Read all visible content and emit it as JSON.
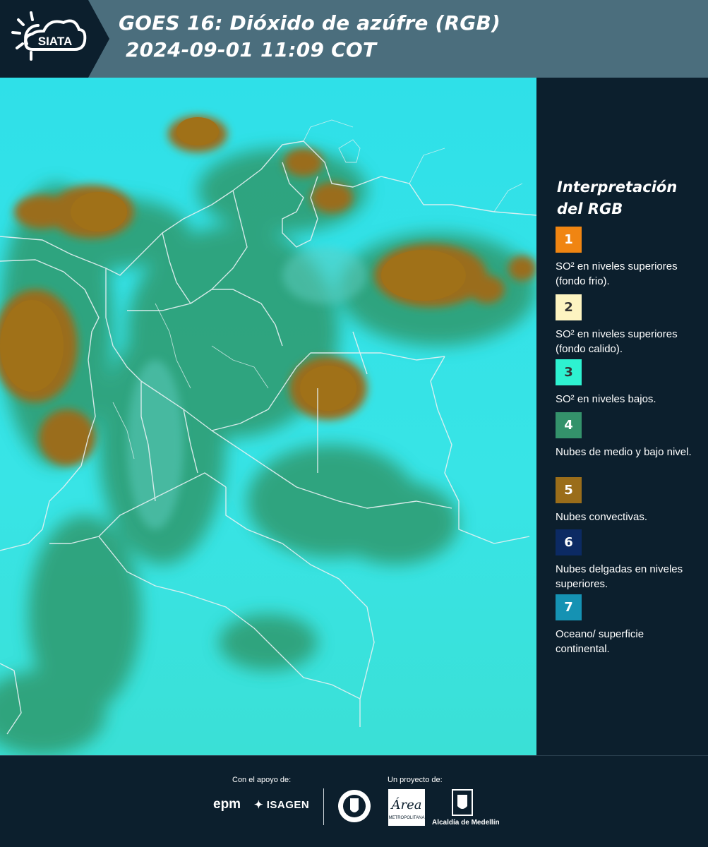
{
  "header": {
    "logo_text": "SIATA",
    "title_line1": "GOES 16: Dióxido de azúfre (RGB)",
    "title_line2": " 2024-09-01 11:09 COT",
    "band_color": "#4b6e7d"
  },
  "map": {
    "icon": "satellite-map",
    "base_color": "#33e0e6",
    "border_color": "#e6f1f3"
  },
  "legend": {
    "title": "Interpretación del RGB",
    "items": [
      {
        "number": "1",
        "color": "#f08512",
        "text_color": "#ffffff",
        "label": "SO² en niveles superiores (fondo frio)."
      },
      {
        "number": "2",
        "color": "#fdf4c1",
        "text_color": "#333333",
        "label": "SO² en niveles superiores (fondo calido)."
      },
      {
        "number": "3",
        "color": "#2ef2d1",
        "text_color": "#333333",
        "label": "SO² en niveles bajos."
      },
      {
        "number": "4",
        "color": "#34926b",
        "text_color": "#ffffff",
        "label": "Nubes de medio y bajo nivel."
      },
      {
        "number": "5",
        "color": "#9a6d1a",
        "text_color": "#ffffff",
        "label": "Nubes convectivas."
      },
      {
        "number": "6",
        "color": "#0c2a63",
        "text_color": "#ffffff",
        "label": "Nubes delgadas en niveles superiores."
      },
      {
        "number": "7",
        "color": "#1592b3",
        "text_color": "#ffffff",
        "label": "Oceano/ superficie continental."
      }
    ]
  },
  "footer": {
    "support_label": "Con el apoyo de:",
    "project_label": "Un proyecto de:",
    "sponsor_epm": "epm",
    "sponsor_isagen": "ISAGEN",
    "area_text": "Área",
    "area_sub": "METROPOLITANA",
    "alcaldia": "Alcaldía de Medellín"
  }
}
